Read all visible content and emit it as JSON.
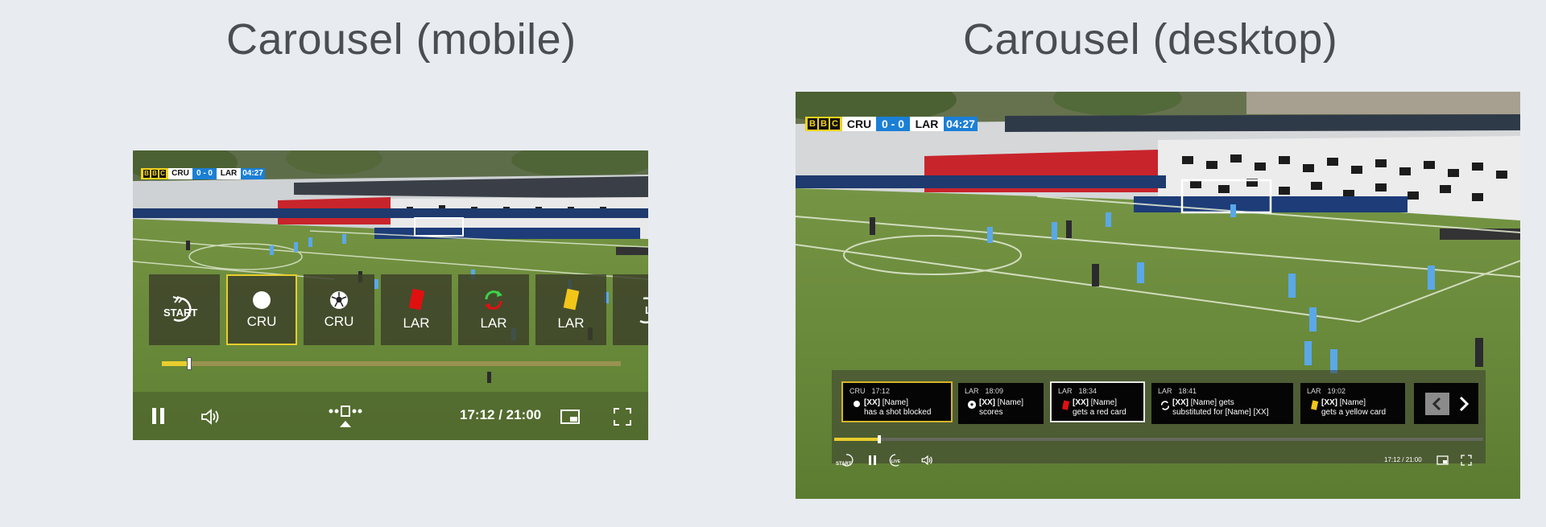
{
  "headings": {
    "mobile": "Carousel (mobile)",
    "desktop": "Carousel (desktop)"
  },
  "scoreboard": {
    "broadcaster": [
      "B",
      "B",
      "C"
    ],
    "home": "CRU",
    "score": "0 - 0",
    "away": "LAR",
    "clock": "04:27"
  },
  "mobile": {
    "tiles": [
      {
        "label": "START",
        "icon": "start-rewind-icon"
      },
      {
        "label": "CRU",
        "icon": "shot-dot-icon",
        "selected": true
      },
      {
        "label": "CRU",
        "icon": "football-icon"
      },
      {
        "label": "LAR",
        "icon": "red-card-icon"
      },
      {
        "label": "LAR",
        "icon": "substitution-icon"
      },
      {
        "label": "LAR",
        "icon": "yellow-card-icon"
      },
      {
        "label": "LIVE",
        "icon": "live-icon"
      }
    ],
    "progress": 0.06,
    "time": "17:12 / 21:00"
  },
  "desktop": {
    "cards": [
      {
        "team": "CRU",
        "time": "17:12",
        "bold": "[XX]",
        "name": "[Name]",
        "line2": "has a shot blocked",
        "icon": "shot-dot-icon",
        "state": "yellow"
      },
      {
        "team": "LAR",
        "time": "18:09",
        "bold": "[XX]",
        "name": "[Name]",
        "line2": "scores",
        "icon": "football-icon",
        "state": "none"
      },
      {
        "team": "LAR",
        "time": "18:34",
        "bold": "[XX]",
        "name": "[Name]",
        "line2": "gets a red card",
        "icon": "red-card-icon",
        "state": "white"
      },
      {
        "team": "LAR",
        "time": "18:41",
        "bold": "[XX]",
        "name": "[Name] gets",
        "line2": "substituted for [Name] [XX]",
        "icon": "substitution-icon",
        "state": "none"
      },
      {
        "team": "LAR",
        "time": "19:02",
        "bold": "[XX]",
        "name": "[Name]",
        "line2": "gets a yellow card",
        "icon": "yellow-card-icon",
        "state": "none"
      }
    ],
    "progress": 0.07,
    "time": "17:12 / 21:00",
    "controls": {
      "start": "START",
      "live": "LIVE"
    }
  },
  "colors": {
    "accent_yellow": "#e8cd2e",
    "score_blue": "#1b7fd6",
    "red_card": "#e01010",
    "yellow_card": "#f2c619",
    "grass": "#6f8e3e"
  }
}
